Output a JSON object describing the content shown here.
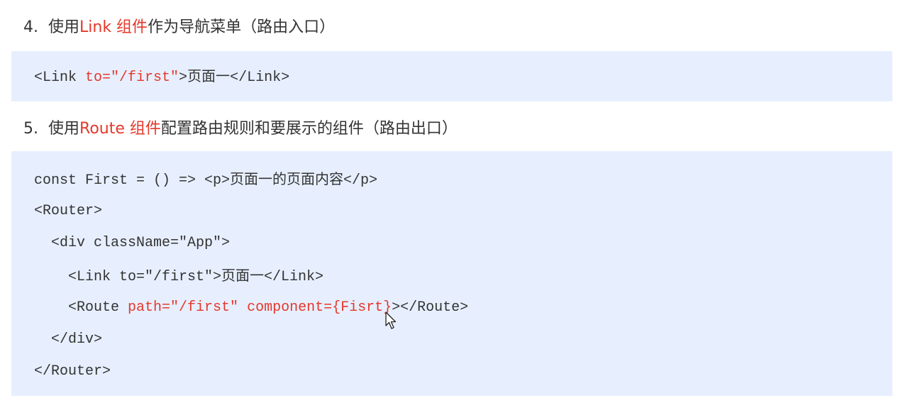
{
  "step4": {
    "number": "4.",
    "prefix": "使用",
    "highlight": "Link 组件",
    "suffix": "作为导航菜单（路由入口）"
  },
  "code1": {
    "line1": {
      "open": "<Link ",
      "attr": "to=\"/first\"",
      "close_bracket": ">",
      "text": "页面一",
      "end_tag": "</Link>"
    }
  },
  "step5": {
    "number": "5.",
    "prefix": "使用",
    "highlight": "Route 组件",
    "suffix": "配置路由规则和要展示的组件（路由出口）"
  },
  "code2": {
    "line1": {
      "code": "const First = () => <p>",
      "text": "页面一的页面内容",
      "end_tag": "</p>"
    },
    "line2": "<Router>",
    "line3": "  <div className=\"App\">",
    "line4": {
      "code": "    <Link to=\"/first\">",
      "text": "页面一",
      "end_tag": "</Link>"
    },
    "line5": {
      "open": "    <Route ",
      "path_attr": "path=\"/first\"",
      "space": " ",
      "component_attr": "component={Fisrt}",
      "end": "></Route>"
    },
    "line6": "  </div>",
    "line7": "</Router>"
  }
}
